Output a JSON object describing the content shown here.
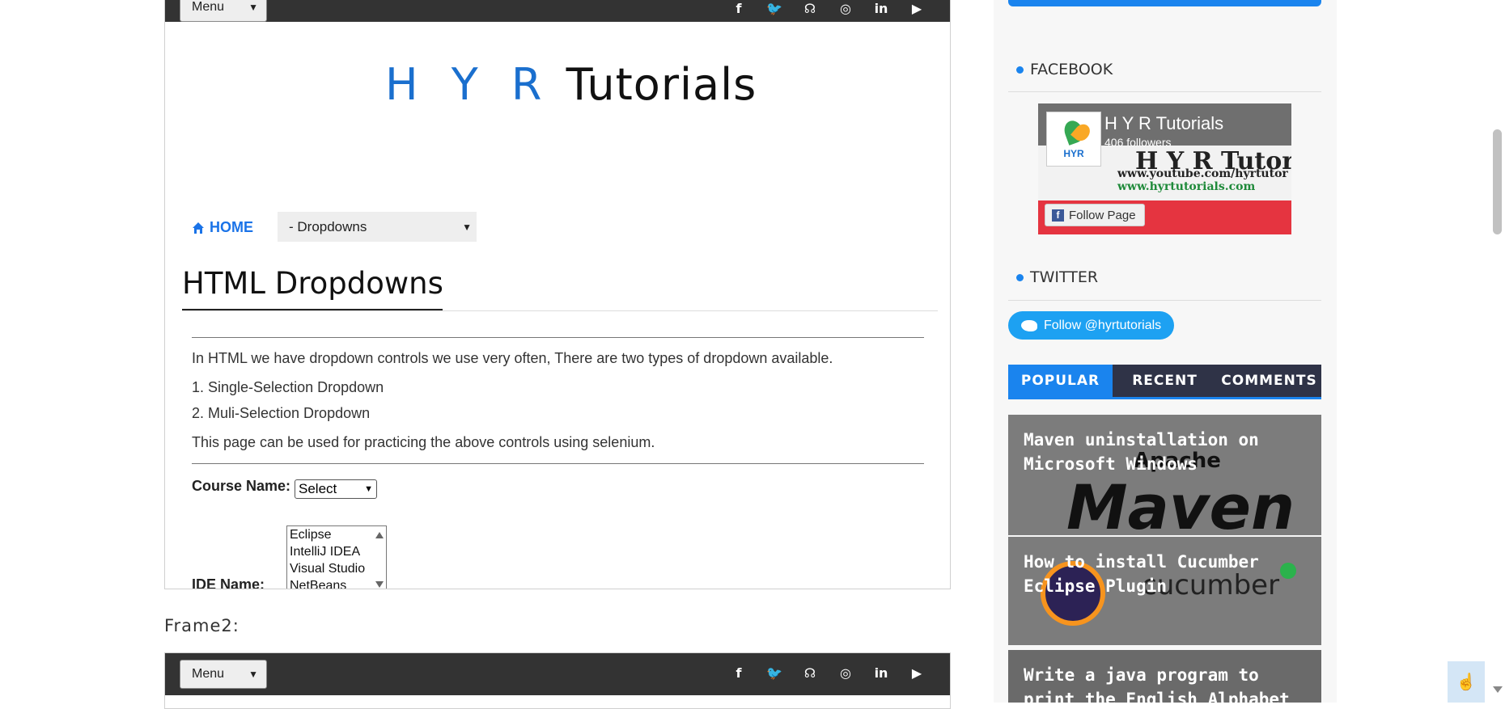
{
  "frame1": {
    "menu_label": "Menu",
    "social_icons": [
      "f",
      "🐦",
      "☊",
      "◎",
      "in",
      "▶"
    ],
    "logo": {
      "hyr": "H Y R",
      "tutorials": "Tutorials"
    },
    "nav": {
      "home": "HOME",
      "dropdown_value": "- Dropdowns"
    },
    "page_title": "HTML Dropdowns",
    "intro": "In HTML we have dropdown controls we use very often, There are two types of dropdown available.",
    "item1": "1. Single-Selection Dropdown",
    "item2": "2. Muli-Selection Dropdown",
    "note": "This page can be used for practicing the above controls using selenium.",
    "course_label": "Course Name:",
    "course_value": "Select",
    "ide_label": "IDE Name:",
    "ide_options": [
      "Eclipse",
      "IntelliJ IDEA",
      "Visual Studio",
      "NetBeans"
    ]
  },
  "frame2": {
    "label": "Frame2:",
    "menu_label": "Menu"
  },
  "sidebar": {
    "facebook_heading": "FACEBOOK",
    "fb_name": "H Y R Tutorials",
    "fb_followers": "406 followers",
    "fb_logo_text": "HYR",
    "fb_banner_title": "H Y R Tutori",
    "fb_banner_url1": "www.youtube.com/hyrtutor",
    "fb_banner_url2": "www.hyrtutorials.com",
    "fb_follow": "Follow Page",
    "twitter_heading": "TWITTER",
    "twitter_follow": "Follow @hyrtutorials",
    "tabs": [
      "POPULAR",
      "RECENT",
      "COMMENTS"
    ],
    "posts": [
      {
        "title": "Maven uninstallation on Microsoft Windows",
        "img_text_a": "Apache",
        "img_text_b": "Maven"
      },
      {
        "title": "How to install Cucumber Eclipse Plugin",
        "img_text": "cucumber"
      },
      {
        "title": "Write a java program to print the English Alphabet in Upper"
      }
    ]
  },
  "colors": {
    "accent": "#1a84ee",
    "topbar": "#333333",
    "twitter": "#1da1f2"
  }
}
